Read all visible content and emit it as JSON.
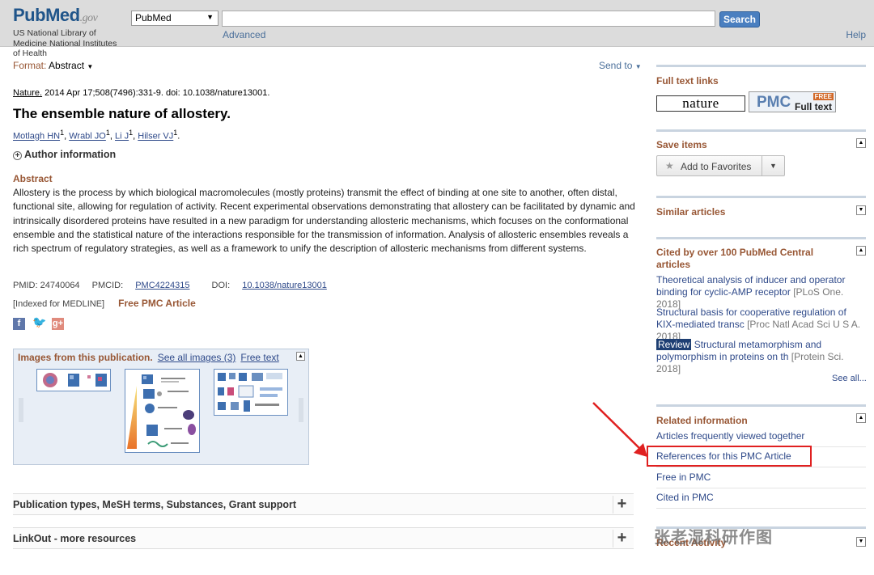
{
  "header": {
    "logo_pub": "Pub",
    "logo_med": "Med",
    "logo_gov": ".gov",
    "nlm": "US National Library of Medicine National Institutes of Health",
    "db_selected": "PubMed",
    "search_value": "",
    "search_button": "Search",
    "advanced": "Advanced",
    "help": "Help"
  },
  "toolbar": {
    "format_label": "Format:",
    "format_value": "Abstract",
    "send_to": "Send to"
  },
  "article": {
    "journal": "Nature.",
    "citation": "2014 Apr 17;508(7496):331-9. doi: 10.1038/nature13001.",
    "title": "The ensemble nature of allostery.",
    "authors": [
      "Motlagh HN",
      "Wrabl JO",
      "Li J",
      "Hilser VJ"
    ],
    "author_info": "Author information",
    "abstract_heading": "Abstract",
    "abstract": "Allostery is the process by which biological macromolecules (mostly proteins) transmit the effect of binding at one site to another, often distal, functional site, allowing for regulation of activity. Recent experimental observations demonstrating that allostery can be facilitated by dynamic and intrinsically disordered proteins have resulted in a new paradigm for understanding allosteric mechanisms, which focuses on the conformational ensemble and the statistical nature of the interactions responsible for the transmission of information. Analysis of allosteric ensembles reveals a rich spectrum of regulatory strategies, as well as a framework to unify the description of allosteric mechanisms from different systems.",
    "pmid_label": "PMID: 24740064",
    "pmcid_label": "PMCID:",
    "pmcid": "PMC4224315",
    "doi_label": "DOI:",
    "doi": "10.1038/nature13001",
    "indexed": "[Indexed for MEDLINE]",
    "free_pmc": "Free PMC Article"
  },
  "images": {
    "heading": "Images from this publication.",
    "see_all": "See all images (3)",
    "free_text": "Free text"
  },
  "sections": {
    "pub_types": "Publication types, MeSH terms, Substances, Grant support",
    "linkout": "LinkOut - more resources"
  },
  "sidebar": {
    "full_text_links": "Full text links",
    "nature_btn": "nature",
    "pmc_btn": "PMC",
    "pmc_full_text": "Full text",
    "pmc_free": "FREE",
    "save_items": "Save items",
    "add_to_favorites": "Add to Favorites",
    "similar_articles": "Similar articles",
    "cited_by": "Cited by over 100 PubMed Central articles",
    "cited_items": [
      {
        "title": "Theoretical analysis of inducer and operator binding for cyclic-AMP receptor",
        "src": "[PLoS One. 2018]"
      },
      {
        "title": "Structural basis for cooperative regulation of KIX-mediated transc",
        "src": "[Proc Natl Acad Sci U S A. 2018]"
      },
      {
        "badge": "Review",
        "title": "Structural metamorphism and polymorphism in proteins on th",
        "src": "[Protein Sci. 2018]"
      }
    ],
    "see_all": "See all...",
    "related_info": "Related information",
    "related_items": [
      "Articles frequently viewed together",
      "References for this PMC Article",
      "Free in PMC",
      "Cited in PMC"
    ],
    "recent_activity": "Recent Activity"
  },
  "watermark": "张老湿科研作图"
}
